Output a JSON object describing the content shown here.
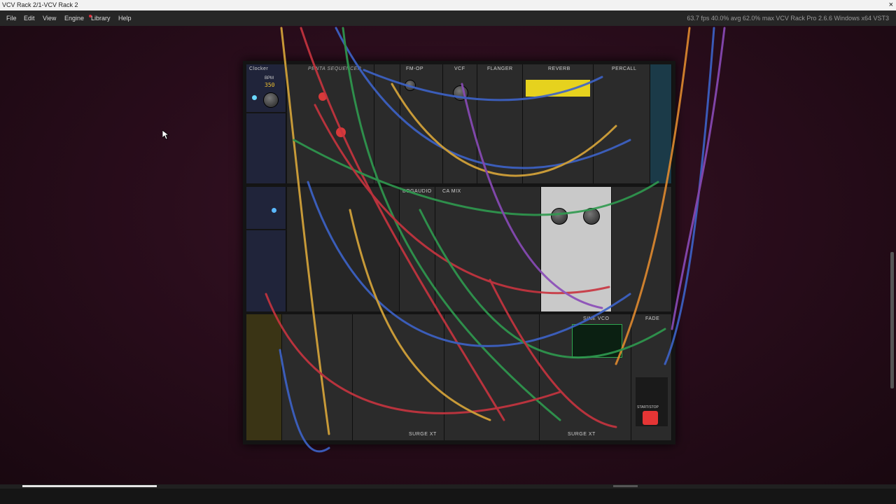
{
  "window": {
    "title": "VCV Rack 2/1-VCV Rack 2",
    "close_glyph": "×"
  },
  "menu": {
    "items": [
      "File",
      "Edit",
      "View",
      "Engine",
      "Library",
      "Help"
    ],
    "library_notification_color": "#e02a3a",
    "status": "63.7 fps  40.0% avg  62.0% max     VCV Rack Pro 2.6.6 Windows x64 VST3"
  },
  "modules": {
    "clocker": {
      "label": "Clocker",
      "bpm_label": "BPM",
      "bpm": "350"
    },
    "penta": {
      "label": "PENTA SEQUENCER"
    },
    "fmop": {
      "label": "FM-OP"
    },
    "vcf": {
      "label": "VCF"
    },
    "flanger": {
      "label": "FLANGER"
    },
    "reverb": {
      "label": "REVERB"
    },
    "percall": {
      "label": "PERCALL"
    },
    "bogaudio": {
      "label": "BOGAUDIO"
    },
    "mix": {
      "label": "CA MIX"
    },
    "sinevco": {
      "label": "SINE VCO"
    },
    "fade": {
      "label": "FADE"
    },
    "surge1": {
      "label": "SURGE XT"
    },
    "surge2": {
      "label": "SURGE XT"
    },
    "timer": {
      "label": "START/STOP"
    }
  },
  "colors": {
    "cable_yellow": "#d9a73a",
    "cable_red": "#c8343f",
    "cable_green": "#2f9a4f",
    "cable_blue": "#3d63c9",
    "cable_purple": "#8a4bb8",
    "cable_orange": "#e08a2f",
    "reverb_display": "#e6d21e",
    "sine_display": "#2fa850",
    "timer_button": "#e53535"
  },
  "icons": {
    "cursor": "mouse-pointer-icon"
  }
}
